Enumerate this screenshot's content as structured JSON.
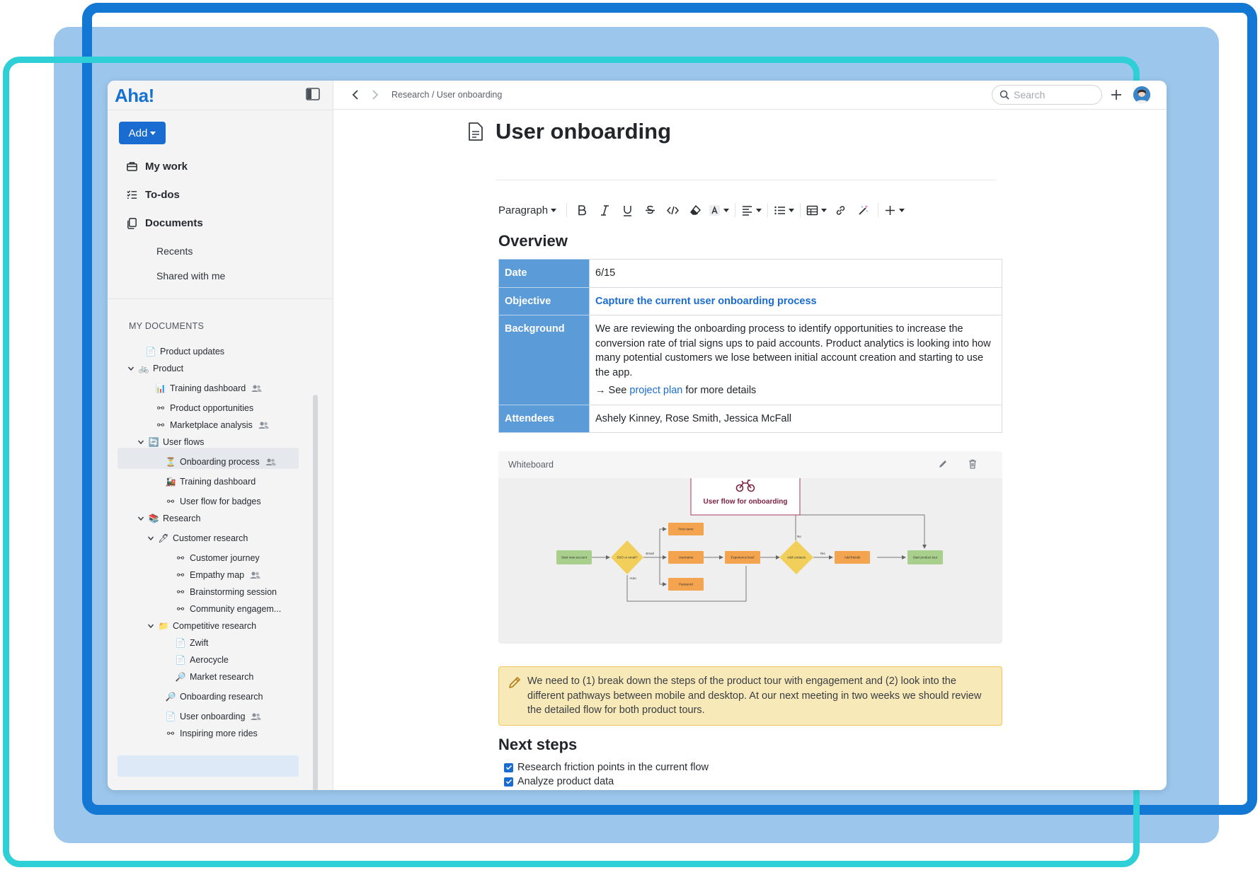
{
  "app": {
    "logo": "Aha!"
  },
  "sidebar": {
    "add_label": "Add",
    "nav": [
      {
        "label": "My work",
        "icon": "briefcase-icon"
      },
      {
        "label": "To-dos",
        "icon": "checklist-icon"
      },
      {
        "label": "Documents",
        "icon": "documents-icon"
      }
    ],
    "sub_nav": [
      "Recents",
      "Shared with me"
    ],
    "my_documents_header": "MY DOCUMENTS",
    "tree": [
      {
        "label": "Product updates",
        "icon": "📄"
      },
      {
        "label": "Product",
        "icon": "🚲"
      },
      {
        "label": "Training dashboard",
        "icon": "📊"
      },
      {
        "label": "Product opportunities",
        "icon": "⚯"
      },
      {
        "label": "Marketplace analysis",
        "icon": "⚯"
      },
      {
        "label": "User flows",
        "icon": "🔄"
      },
      {
        "label": "Onboarding process",
        "icon": "⏳"
      },
      {
        "label": "Training dashboard",
        "icon": "🚂"
      },
      {
        "label": "User flow for badges",
        "icon": "⚯"
      },
      {
        "label": "Research",
        "icon": "📚"
      },
      {
        "label": "Customer research",
        "icon": "🖊"
      },
      {
        "label": "Customer journey",
        "icon": "⚯"
      },
      {
        "label": "Empathy map",
        "icon": "⚯"
      },
      {
        "label": "Brainstorming session",
        "icon": "⚯"
      },
      {
        "label": "Community engagem...",
        "icon": "⚯"
      },
      {
        "label": "Competitive research",
        "icon": "📁"
      },
      {
        "label": "Zwift",
        "icon": "📄"
      },
      {
        "label": "Aerocycle",
        "icon": "📄"
      },
      {
        "label": "Market research",
        "icon": "🔎"
      },
      {
        "label": "Onboarding research",
        "icon": "🔎"
      },
      {
        "label": "User onboarding",
        "icon": "📄"
      },
      {
        "label": "Inspiring more rides",
        "icon": "⚯"
      }
    ]
  },
  "topbar": {
    "breadcrumb": "Research / User onboarding",
    "search_placeholder": "Search"
  },
  "document": {
    "title": "User onboarding",
    "toolbar": {
      "paragraph": "Paragraph"
    },
    "overview_heading": "Overview",
    "table": {
      "date_label": "Date",
      "date_value": "6/15",
      "objective_label": "Objective",
      "objective_value": "Capture the current user onboarding process",
      "background_label": "Background",
      "background_value": "We are reviewing the onboarding process to identify opportunities to increase the conversion rate of trial signs ups to paid accounts. Product analytics is looking into how many potential customers we lose between initial account creation and starting to use the app.",
      "see_prefix": "→ See",
      "see_link": "project plan",
      "see_suffix": "for more details",
      "attendees_label": "Attendees",
      "attendees_value": "Ashely Kinney, Rose Smith, Jessica McFall"
    },
    "whiteboard": {
      "label": "Whiteboard",
      "card_title": "User flow for onboarding",
      "nodes": {
        "start": "Start new account",
        "sso": "SSO or email?",
        "first_name": "First name",
        "username": "Username",
        "password": "Password",
        "experience_level": "Experience level",
        "add_contacts": "Add contacts",
        "add_friends": "Add friends",
        "start_product_tour": "Start product tour",
        "email": "Email",
        "auto": "Auto",
        "no": "No",
        "yes": "Yes"
      }
    },
    "callout": "We need to (1) break down the steps of the product tour with engagement and (2) look into the different pathways between mobile and desktop. At our next meeting in two weeks we should review the detailed flow for both product tours.",
    "next_steps_heading": "Next steps",
    "next_steps": [
      {
        "label": "Research friction points in the current flow",
        "checked": true
      },
      {
        "label": "Analyze product data",
        "checked": true
      }
    ]
  },
  "colors": {
    "accent": "#1a6cd0",
    "table_header": "#5b9bd8",
    "callout_bg": "#f8e9b8",
    "frame_blue": "#1278d4",
    "frame_teal": "#2fcfd8"
  }
}
